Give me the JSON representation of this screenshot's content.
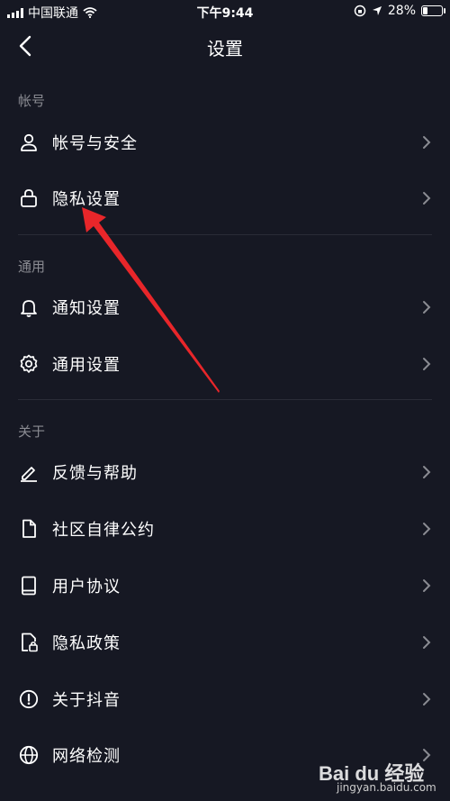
{
  "status_bar": {
    "carrier": "中国联通",
    "time": "下午9:44",
    "battery": "28%",
    "battery_level": 0.28
  },
  "header": {
    "title": "设置",
    "back_icon": "chevron-left-icon"
  },
  "sections": [
    {
      "label": "帐号",
      "items": [
        {
          "label": "帐号与安全",
          "icon": "user-icon"
        },
        {
          "label": "隐私设置",
          "icon": "lock-icon"
        }
      ]
    },
    {
      "label": "通用",
      "items": [
        {
          "label": "通知设置",
          "icon": "bell-icon"
        },
        {
          "label": "通用设置",
          "icon": "gear-icon"
        }
      ]
    },
    {
      "label": "关于",
      "items": [
        {
          "label": "反馈与帮助",
          "icon": "pen-icon"
        },
        {
          "label": "社区自律公约",
          "icon": "document-icon"
        },
        {
          "label": "用户协议",
          "icon": "book-icon"
        },
        {
          "label": "隐私政策",
          "icon": "file-lock-icon"
        },
        {
          "label": "关于抖音",
          "icon": "info-icon"
        },
        {
          "label": "网络检测",
          "icon": "globe-icon"
        }
      ]
    }
  ],
  "watermark": {
    "brand": "Bai du 经验",
    "site": "jingyan.baidu.com"
  },
  "colors": {
    "background": "#161823",
    "text": "#ffffff",
    "muted": "#8a8b92",
    "annotation_arrow": "#e8262a"
  }
}
